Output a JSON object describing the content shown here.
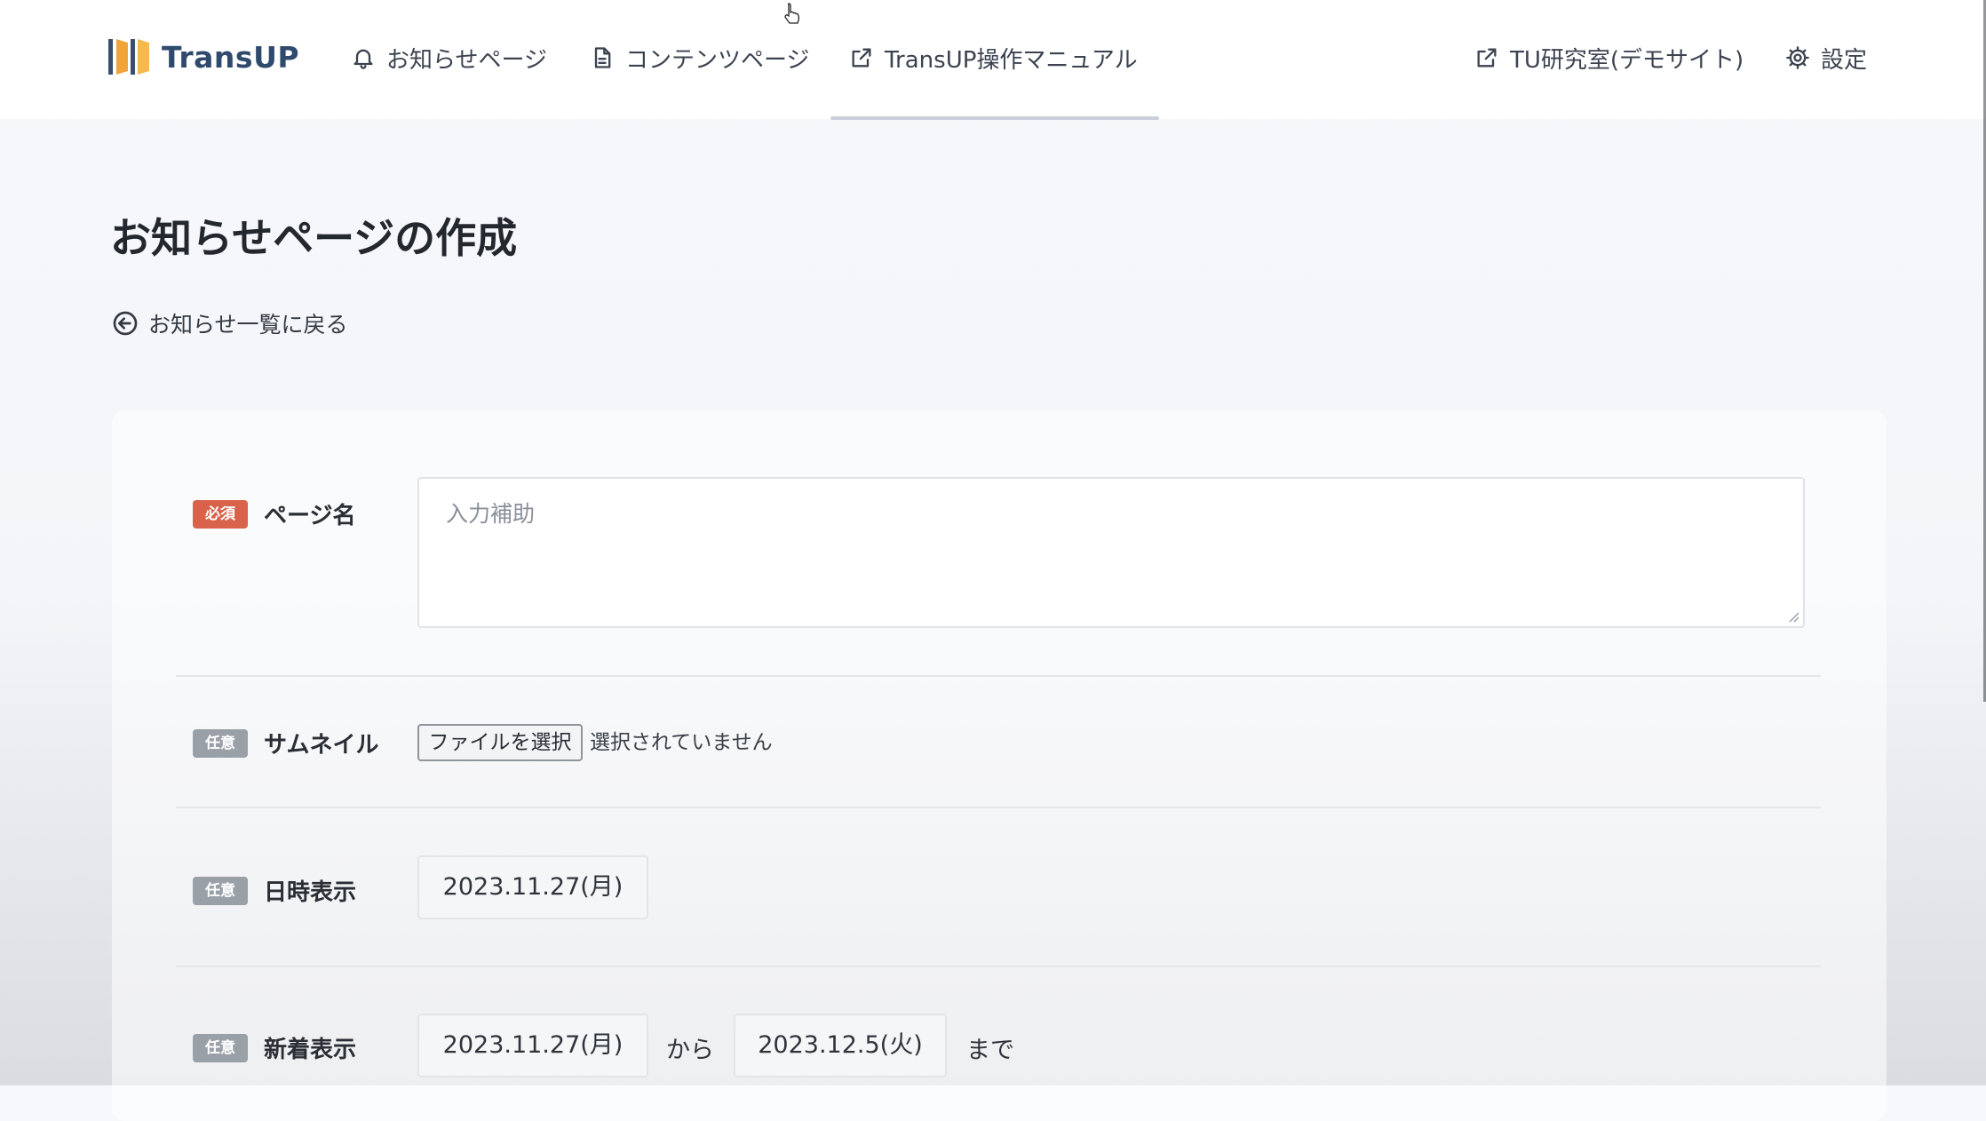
{
  "header": {
    "logo_text": "TransUP",
    "nav": {
      "notices": "お知らせページ",
      "contents": "コンテンツページ",
      "manual": "TransUP操作マニュアル",
      "lab": "TU研究室(デモサイト)",
      "settings": "設定"
    }
  },
  "page": {
    "title": "お知らせページの作成",
    "back_link": "お知らせ一覧に戻る"
  },
  "badges": {
    "required": "必須",
    "optional": "任意"
  },
  "form": {
    "page_name": {
      "label": "ページ名",
      "placeholder": "入力補助"
    },
    "thumbnail": {
      "label": "サムネイル",
      "button": "ファイルを選択",
      "status": "選択されていません"
    },
    "date_display": {
      "label": "日時表示",
      "value": "2023.11.27(月)"
    },
    "new_display": {
      "label": "新着表示",
      "from": "2023.11.27(月)",
      "from_text": "から",
      "to": "2023.12.5(火)",
      "to_text": "まで"
    }
  },
  "colors": {
    "brand": "#2f4a6d",
    "logo_orange": "#f0a43a",
    "badge_required": "#d9624a",
    "badge_optional": "#9aa0a8"
  }
}
